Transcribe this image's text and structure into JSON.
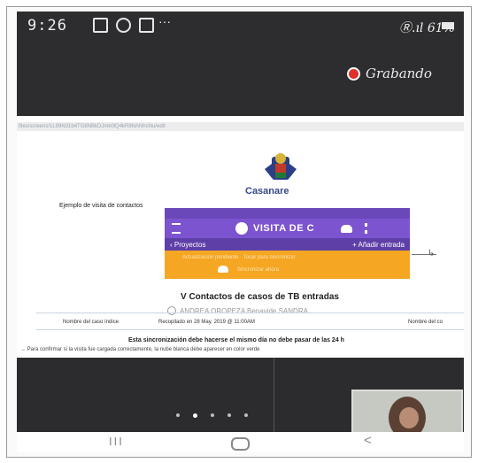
{
  "status_bar": {
    "time": "9:26",
    "signal_text": "Ⓡ.ıl 61%"
  },
  "recording": {
    "label": "Grabando"
  },
  "url_text": "files/screens/1L99N31b4TG8NBkDJmk0lQ4kR8NANhcNu/edit",
  "document": {
    "logo_text": "Casanare",
    "subtitle": "Ejemplo de visita de contactos",
    "app_screen": {
      "title": "VISITA DE C",
      "nav_left": "‹ Proyectos",
      "nav_right": "+ Añadir entrada",
      "orange_line1": "Actualización pendiente · Tocar para sincronizar",
      "orange_line2": "Sincronizar ahora"
    },
    "section_title": "V Contactos de casos de TB entradas",
    "caption": "ANDREA OROPEZA Benavide SANDRA",
    "table": {
      "col_a": "Nombre del caso índice",
      "col_b": "Recopilado en 28 May. 2019 @ 11:00AM",
      "col_c": "Nombre del co"
    },
    "note_bold": "Esta sincronización debe hacerse el mismo día no debe pasar de las 24 h",
    "note_text": "→ Para confirmar si la visita fue cargada correctamente, la nube blanca debe aparecer en color verde"
  },
  "nav_bar": {
    "recents": "III",
    "back": "<"
  },
  "colors": {
    "video_bg": "#2d2d2f",
    "app_purple": "#7c54cf",
    "app_orange": "#f5a623",
    "record_red": "#e0302a"
  }
}
